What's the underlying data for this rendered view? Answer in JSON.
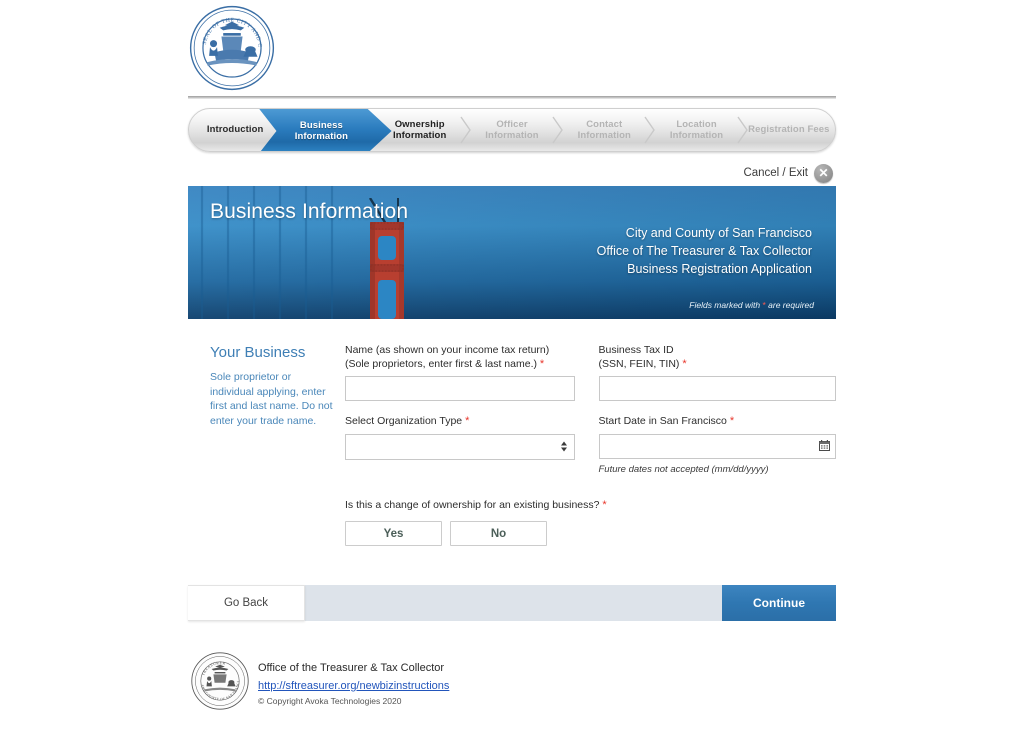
{
  "colors": {
    "accent_blue": "#2f77b2",
    "banner_blue": "#1b6ba9",
    "link_blue": "#2255bb",
    "side_text_blue": "#4a87b9",
    "required_red": "#e8352a",
    "action_bar_bg": "#dde3ea"
  },
  "header": {
    "seal_alt": "seal-of-the-city-and-county-of-san-francisco"
  },
  "progress": {
    "steps": [
      {
        "label": "Introduction",
        "state": "done"
      },
      {
        "label": "Business\nInformation",
        "line1": "Business",
        "line2": "Information",
        "state": "active"
      },
      {
        "label": "Ownership Information",
        "line1": "Ownership",
        "line2": "Information",
        "state": "next"
      },
      {
        "label": "Officer Information",
        "line1": "Officer",
        "line2": "Information",
        "state": "upcoming"
      },
      {
        "label": "Contact Information",
        "line1": "Contact",
        "line2": "Information",
        "state": "upcoming"
      },
      {
        "label": "Location Information",
        "line1": "Location",
        "line2": "Information",
        "state": "upcoming"
      },
      {
        "label": "Registration Fees",
        "line1": "Registration Fees",
        "line2": "",
        "state": "upcoming"
      }
    ]
  },
  "cancel": {
    "label": "Cancel / Exit",
    "icon_glyph": "✕"
  },
  "banner": {
    "title": "Business Information",
    "agency_line1": "City and County of San Francisco",
    "agency_line2": "Office of The Treasurer & Tax Collector",
    "agency_line3": "Business Registration Application",
    "required_prefix": "Fields marked with ",
    "required_asterisk": "*",
    "required_suffix": " are required"
  },
  "side": {
    "title": "Your Business",
    "help": "Sole proprietor or individual applying, enter first and last name. Do not enter your trade name."
  },
  "form": {
    "name_label_line1": "Name (as shown on your income tax return)",
    "name_label_line2": "(Sole proprietors, enter first & last name.)",
    "name_value": "",
    "name_placeholder": "",
    "taxid_label_line1": "Business Tax ID",
    "taxid_label_line2": "(SSN, FEIN, TIN)",
    "taxid_value": "",
    "taxid_placeholder": "",
    "org_label": "Select Organization Type",
    "org_selected": "",
    "org_options": [
      ""
    ],
    "startdate_label": "Start Date in San Francisco",
    "startdate_value": "",
    "startdate_placeholder": "",
    "startdate_hint": "Future dates not accepted (mm/dd/yyyy)",
    "required_mark": "*",
    "ownership_question": "Is this a change of ownership for an existing business?",
    "yes_label": "Yes",
    "no_label": "No"
  },
  "actions": {
    "go_back": "Go Back",
    "continue": "Continue"
  },
  "footer": {
    "office": "Office of the Treasurer & Tax Collector",
    "link": "http://sftreasurer.org/newbizinstructions",
    "copyright": "© Copyright Avoka Technologies 2020",
    "seal_alt": "treasurer-and-tax-collector-seal"
  }
}
